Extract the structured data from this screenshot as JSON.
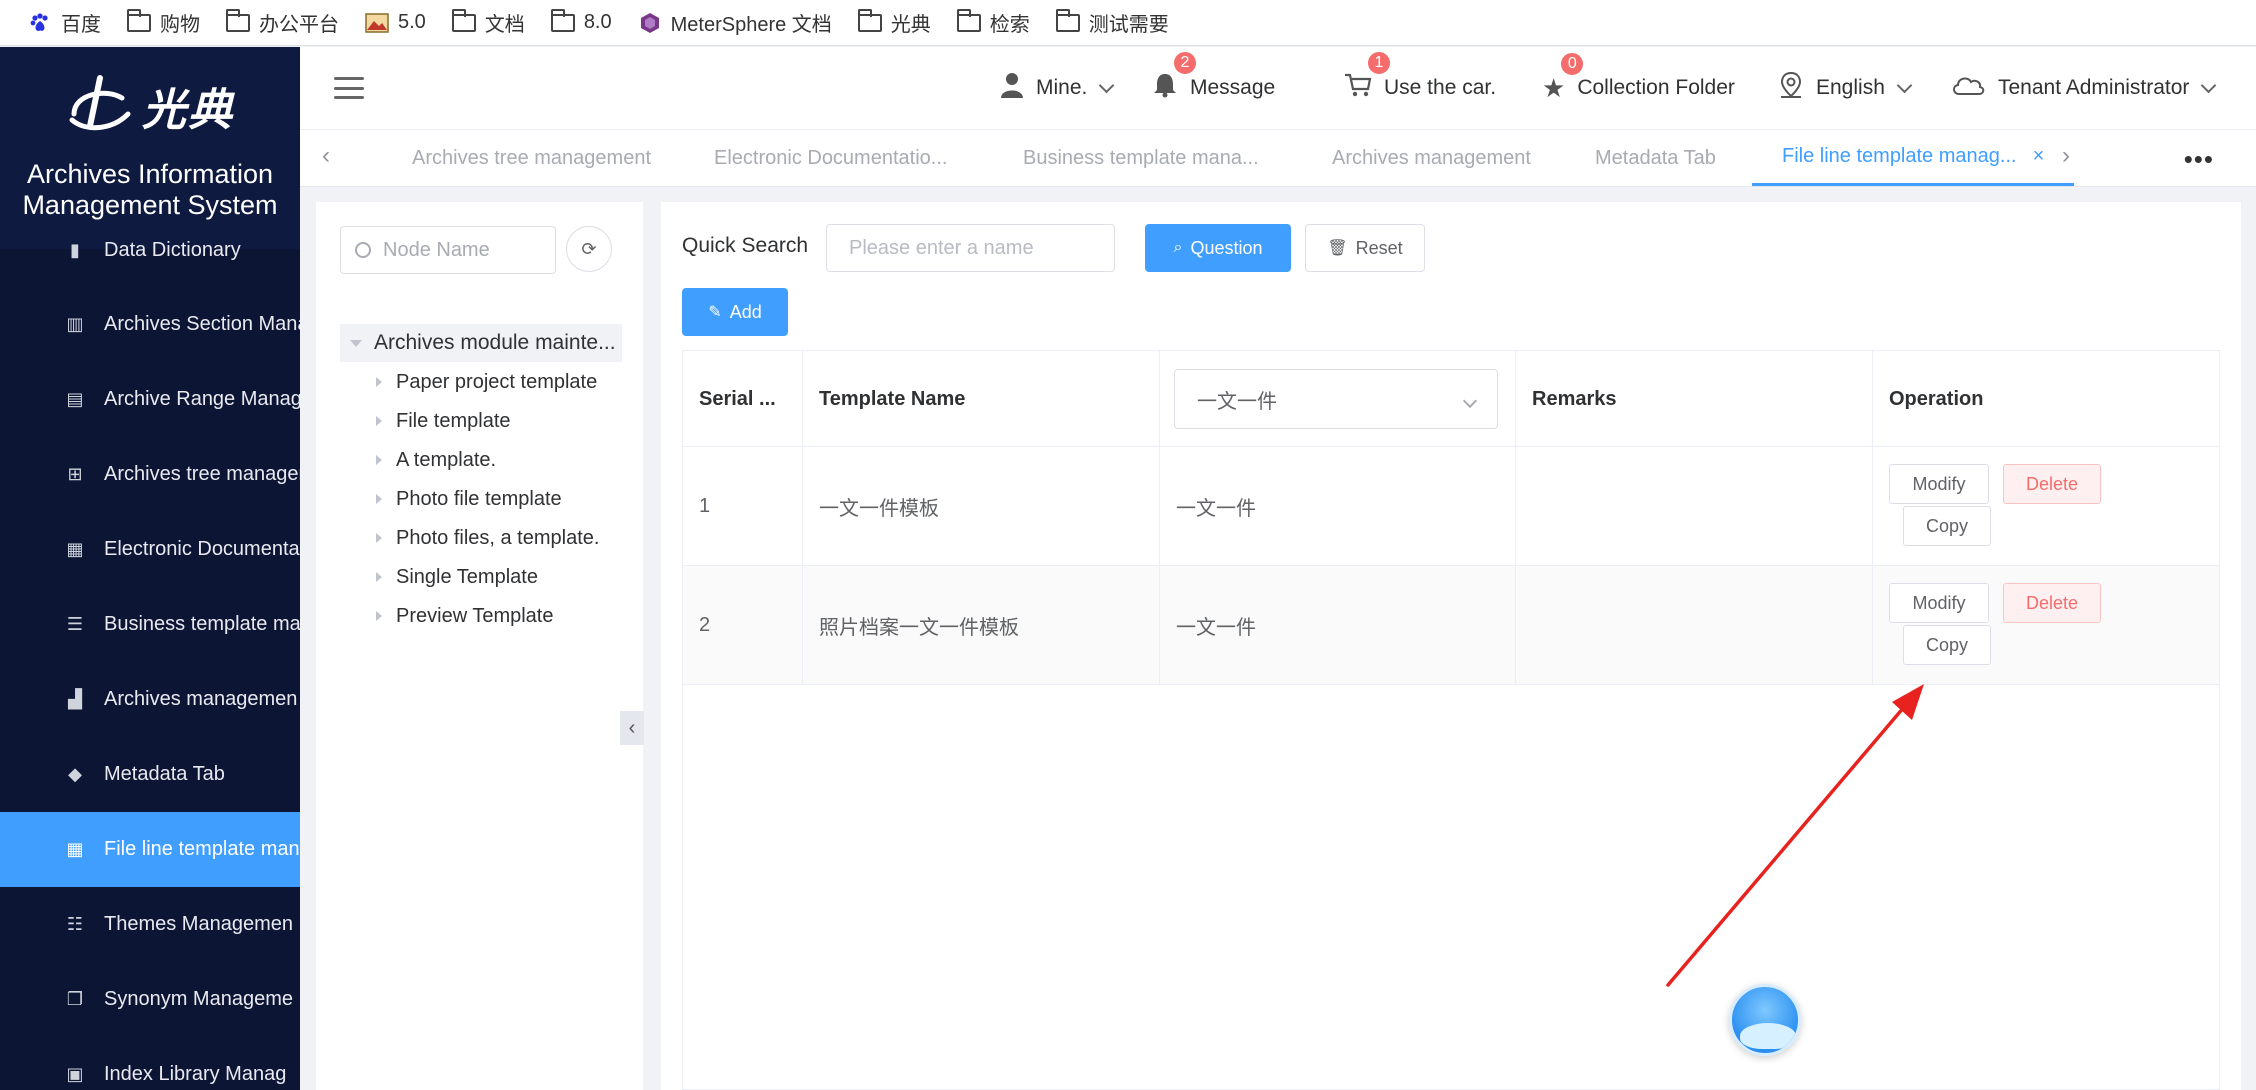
{
  "bookmarks": [
    {
      "label": "百度",
      "icon": "paw-icon"
    },
    {
      "label": "购物",
      "icon": "folder-icon"
    },
    {
      "label": "办公平台",
      "icon": "folder-icon"
    },
    {
      "label": "5.0",
      "icon": "image-icon"
    },
    {
      "label": "文档",
      "icon": "folder-icon"
    },
    {
      "label": "8.0",
      "icon": "folder-icon"
    },
    {
      "label": "MeterSphere 文档",
      "icon": "metersphere-icon"
    },
    {
      "label": "光典",
      "icon": "folder-icon"
    },
    {
      "label": "检索",
      "icon": "folder-icon"
    },
    {
      "label": "测试需要",
      "icon": "folder-icon"
    }
  ],
  "sidebar": {
    "logo_text": "光典",
    "system_title_line1": "Archives Information",
    "system_title_line2": "Management System",
    "items": [
      {
        "label": "Data Dictionary",
        "icon": "book-icon"
      },
      {
        "label": "Archives Section Mana",
        "icon": "books-icon"
      },
      {
        "label": "Archive Range Manag",
        "icon": "document-icon"
      },
      {
        "label": "Archives tree managem",
        "icon": "sitemap-icon"
      },
      {
        "label": "Electronic Documentati",
        "icon": "building-icon"
      },
      {
        "label": "Business template ma",
        "icon": "list-box-icon"
      },
      {
        "label": "Archives managemen",
        "icon": "bar-chart-icon"
      },
      {
        "label": "Metadata Tab",
        "icon": "tag-icon"
      },
      {
        "label": "File line template man",
        "icon": "table-icon"
      },
      {
        "label": "Themes Managemen",
        "icon": "list-icon"
      },
      {
        "label": "Synonym Manageme",
        "icon": "copy-icon"
      },
      {
        "label": "Index Library Manag",
        "icon": "database-icon"
      }
    ]
  },
  "header": {
    "user_menu": "Mine.",
    "message": {
      "label": "Message",
      "badge": "2"
    },
    "cart": {
      "label": "Use the car.",
      "badge": "1"
    },
    "collection": {
      "label": "Collection Folder",
      "badge": "0"
    },
    "language": "English",
    "role": "Tenant Administrator"
  },
  "tabs": [
    {
      "label": "Archives tree management"
    },
    {
      "label": "Electronic Documentatio..."
    },
    {
      "label": "Business template mana..."
    },
    {
      "label": "Archives management"
    },
    {
      "label": "Metadata Tab"
    },
    {
      "label": "File line template manag..."
    }
  ],
  "tree": {
    "search_placeholder": "Node Name",
    "root": "Archives module mainte...",
    "children": [
      "Paper project template",
      "File template",
      "A template.",
      "Photo file template",
      "Photo files, a template.",
      "Single Template",
      "Preview Template"
    ]
  },
  "search": {
    "label": "Quick Search",
    "placeholder": "Please enter a name",
    "question_button": "Question",
    "reset_button": "Reset",
    "add_button": "Add"
  },
  "table": {
    "headers": {
      "serial": "Serial ...",
      "template_name": "Template Name",
      "type_filter": "一文一件",
      "remarks": "Remarks",
      "operation": "Operation"
    },
    "rows": [
      {
        "serial": "1",
        "template_name": "一文一件模板",
        "type": "一文一件",
        "remarks": ""
      },
      {
        "serial": "2",
        "template_name": "照片档案一文一件模板",
        "type": "一文一件",
        "remarks": ""
      }
    ],
    "actions": {
      "modify": "Modify",
      "delete": "Delete",
      "copy": "Copy"
    }
  },
  "colors": {
    "primary": "#409eff",
    "sidebar_bg": "#0d1535",
    "danger": "#f56c6c",
    "annotation_arrow": "#e8231f"
  }
}
